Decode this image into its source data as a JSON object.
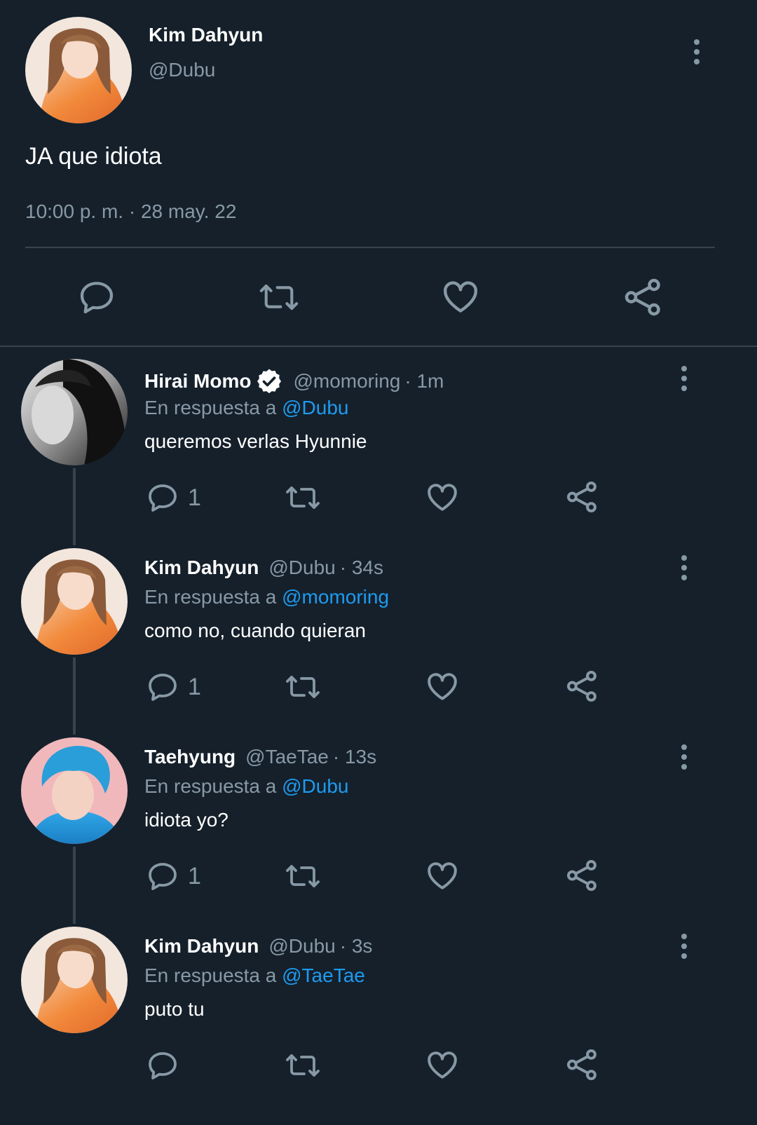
{
  "main_tweet": {
    "name": "Kim Dahyun",
    "handle": "@Dubu",
    "text": "JA que idiota",
    "meta": "10:00 p. m. · 28 may. 22"
  },
  "replies": [
    {
      "name": "Hirai Momo",
      "handle": "@momoring",
      "time": "· 1m",
      "reply_prefix": "En respuesta a",
      "reply_to": "@Dubu",
      "text": "queremos verlas Hyunnie",
      "reply_count": "1"
    },
    {
      "name": "Kim Dahyun",
      "handle": "@Dubu",
      "time": "· 34s",
      "reply_prefix": "En respuesta a",
      "reply_to": "@momoring",
      "text": "como no, cuando quieran",
      "reply_count": "1"
    },
    {
      "name": "Taehyung",
      "handle": "@TaeTae",
      "time": "· 13s",
      "reply_prefix": "En respuesta a",
      "reply_to": "@Dubu",
      "text": "idiota yo?",
      "reply_count": "1"
    },
    {
      "name": "Kim Dahyun",
      "handle": "@Dubu",
      "time": "· 3s",
      "reply_prefix": "En respuesta a",
      "reply_to": "@TaeTae",
      "text": "puto tu",
      "reply_count": ""
    }
  ],
  "icons": {
    "reply": "reply-icon",
    "retweet": "retweet-icon",
    "like": "heart-icon",
    "share": "share-icon",
    "more": "more-vertical-icon",
    "verified": "verified-badge-icon"
  },
  "colors": {
    "background": "#15202b",
    "muted": "#8899a6",
    "link": "#1d9bf0",
    "divider": "#38444d"
  }
}
